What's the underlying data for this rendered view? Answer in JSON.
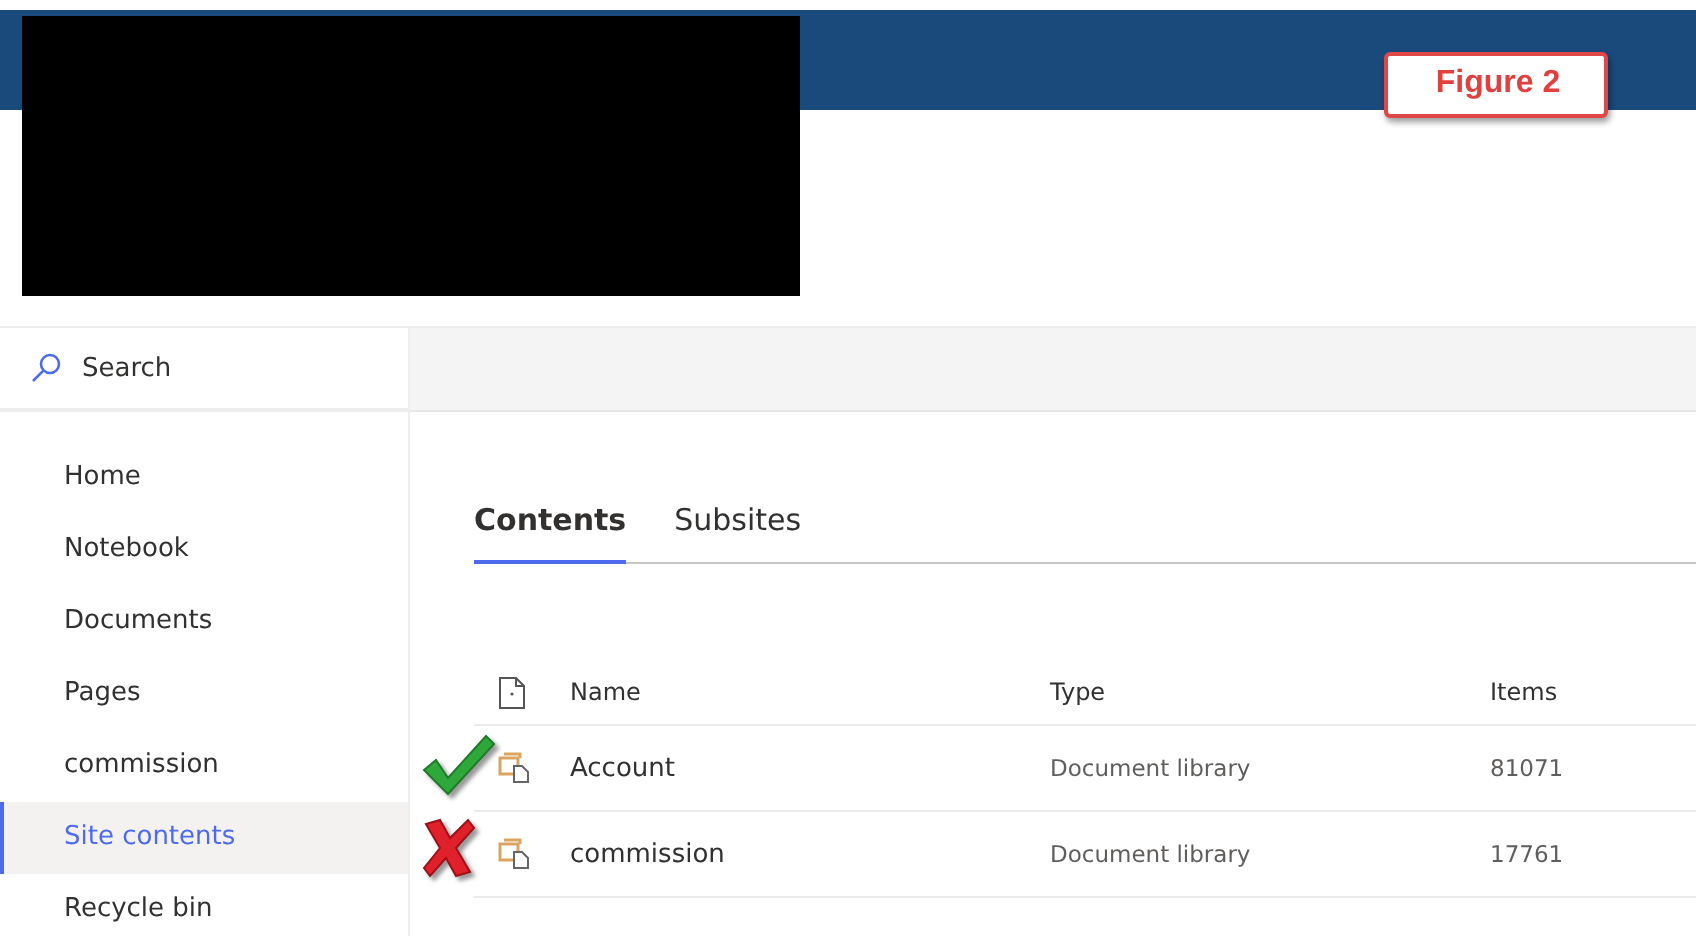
{
  "header": {
    "figure_label": "Figure 2"
  },
  "search": {
    "placeholder": "Search"
  },
  "sidebar": {
    "items": [
      {
        "label": "Home",
        "selected": false
      },
      {
        "label": "Notebook",
        "selected": false
      },
      {
        "label": "Documents",
        "selected": false
      },
      {
        "label": "Pages",
        "selected": false
      },
      {
        "label": "commission",
        "selected": false
      },
      {
        "label": "Site contents",
        "selected": true
      },
      {
        "label": "Recycle bin",
        "selected": false
      }
    ]
  },
  "tabs": [
    {
      "label": "Contents",
      "selected": true
    },
    {
      "label": "Subsites",
      "selected": false
    }
  ],
  "table": {
    "columns": [
      "Name",
      "Type",
      "Items"
    ],
    "rows": [
      {
        "name": "Account",
        "type": "Document library",
        "items": "81071",
        "kind": "check"
      },
      {
        "name": "commission",
        "type": "Document library",
        "items": "17761",
        "kind": "cross"
      }
    ]
  }
}
